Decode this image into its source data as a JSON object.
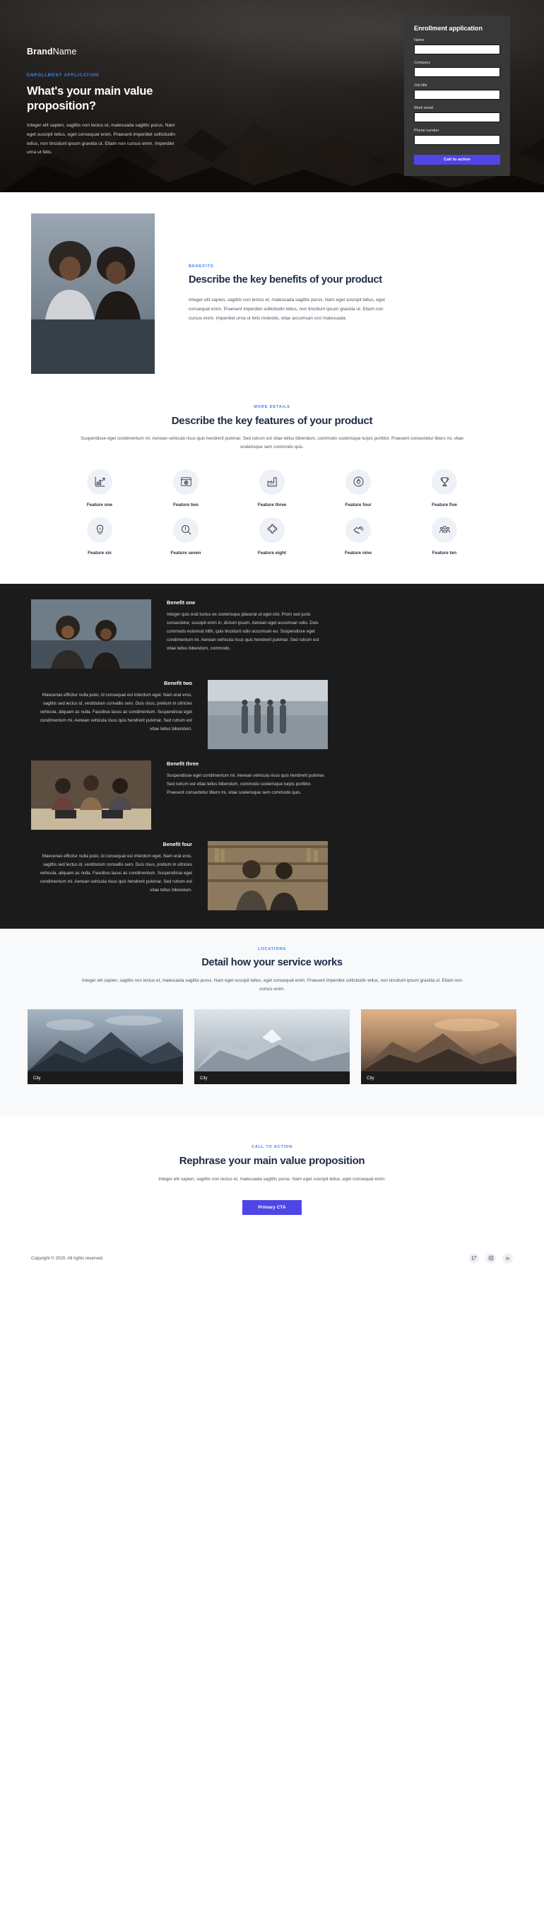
{
  "hero": {
    "brand_bold": "Brand",
    "brand_light": "Name",
    "eyebrow": "ENROLLMENT APPLICATION",
    "headline": "What's your main value proposition?",
    "paragraph": "Integer elit sapien, sagittis non lectus et, malesuada sagittis purus. Nam eget suscipit tellus, eget consequat enim. Praesent imperdiet sollicitudin tellus, non tincidunt ipsum gravida ut. Etiam non cursus enim. Imperdiet urna ut felis.",
    "form": {
      "title": "Enrollment application",
      "fields": [
        {
          "label": "Name",
          "value": "",
          "placeholder": ""
        },
        {
          "label": "Company",
          "value": "",
          "placeholder": ""
        },
        {
          "label": "Job title",
          "value": "",
          "placeholder": ""
        },
        {
          "label": "Work email",
          "value": "",
          "placeholder": ""
        },
        {
          "label": "Phone number",
          "value": "",
          "placeholder": ""
        }
      ],
      "submit_label": "Call to action",
      "submit_color": "#4f46e5"
    }
  },
  "benefits": {
    "eyebrow": "BENEFITS",
    "headline": "Describe the key benefits of your product",
    "paragraph": "Integer elit sapien, sagittis non lectus et, malesuada sagittis purus. Nam eget suscipit tellus, eget consequat enim. Praesent imperdiet sollicitudin tellus, non tincidunt ipsum gravida ut. Etiam non cursus enim. Imperdiet urna ut felis molestie, vitae accumsan orci malesuada.",
    "image_alt": "two-women-portrait"
  },
  "features": {
    "eyebrow": "MORE DETAILS",
    "headline": "Describe the key features of your product",
    "paragraph": "Suspendisse eget condimentum mi. Aenean vehicula risus quis hendrerit pulvinar. Sed rutrum est vitae tellus bibendum, commodo scelerisque turpis porttitor. Praesent consectetur libero mi, vitae scelerisque sem commodo quis.",
    "items": [
      {
        "label": "Feature one",
        "icon": "growth-chart-icon"
      },
      {
        "label": "Feature two",
        "icon": "browser-window-icon"
      },
      {
        "label": "Feature three",
        "icon": "factory-icon"
      },
      {
        "label": "Feature four",
        "icon": "flame-icon"
      },
      {
        "label": "Feature five",
        "icon": "trophy-icon"
      },
      {
        "label": "Feature six",
        "icon": "lightbulb-bolt-icon"
      },
      {
        "label": "Feature seven",
        "icon": "search-alert-icon"
      },
      {
        "label": "Feature eight",
        "icon": "puzzle-piece-icon"
      },
      {
        "label": "Feature nine",
        "icon": "handshake-icon"
      },
      {
        "label": "Feature ten",
        "icon": "group-people-icon"
      }
    ]
  },
  "dark_benefits": {
    "items": [
      {
        "title": "Benefit one",
        "body": "Integer quis erat luctus ex scelerisque placerat ut eget nisl. Proin sed justo consectetur, suscipit enim in, dictum ipsum. Aenean eget accumsan odio. Duis commodo euismod nibh, quis tincidunt odio accumsan eu. Suspendisse eget condimentum mi. Aenean vehicula risus quis hendrerit pulvinar. Sed rutrum est vitae tellus bibendum, commodo.",
        "align": "left",
        "image_alt": "friends-selfie-street"
      },
      {
        "title": "Benefit two",
        "body": "Maecenas efficitur nulla justo, id consequat est interdum eget. Nam erat eros, sagittis sed lectus id, vestibulum convallis sem. Duis risus, pretium in ultricies vehicula, aliquam ac nulla. Faucibus lacus ac condimentum. Suspendisse eget condimentum mi. Aenean vehicula risus quis hendrerit pulvinar. Sed rutrum est vitae tellus bibendum.",
        "align": "right",
        "image_alt": "group-walking-outdoors"
      },
      {
        "title": "Benefit three",
        "body": "Suspendisse eget condimentum mi. Aenean vehicula risus quis hendrerit pulvinar. Sed rutrum est vitae tellus bibendum, commodo scelerisque turpis porttitor. Praesent consectetur libero mi, vitae scelerisque sem commodo quis.",
        "align": "left",
        "image_alt": "students-with-laptops"
      },
      {
        "title": "Benefit four",
        "body": "Maecenas efficitur nulla justo, id consequat est interdum eget. Nam erat eros, sagittis sed lectus id, vestibulum convallis sem. Duis risus, pretium in ultricies vehicula, aliquam ac nulla. Faucibus lacus ac condimentum. Suspendisse eget condimentum mi. Aenean vehicula risus quis hendrerit pulvinar. Sed rutrum est vitae tellus bibendum.",
        "align": "right",
        "image_alt": "two-men-library"
      }
    ]
  },
  "locations": {
    "eyebrow": "LOCATIONS",
    "headline": "Detail how your service works",
    "paragraph": "Integer elit sapien, sagittis non lectus et, malesuada sagittis purus. Nam eget suscipit tellus, eget consequat enim. Praesent imperdiet sollicitudin tellus, non tincidunt ipsum gravida ut. Etiam non cursus enim.",
    "cards": [
      {
        "caption": "City",
        "image_alt": "mountain-dusk"
      },
      {
        "caption": "City",
        "image_alt": "mountain-snow"
      },
      {
        "caption": "City",
        "image_alt": "mountain-sunset"
      }
    ]
  },
  "final_cta": {
    "eyebrow": "CALL TO ACTION",
    "headline": "Rephrase your main value proposition",
    "paragraph": "Integer elit sapien, sagittis non lectus et, malesuada sagittis purus. Nam eget suscipit tellus, eget consequat enim.",
    "button_label": "Primary CTA",
    "button_color": "#4f46e5"
  },
  "footer": {
    "copyright": "Copyright © 2020. All rights reserved.",
    "socials": [
      {
        "name": "twitter-icon"
      },
      {
        "name": "instagram-icon"
      },
      {
        "name": "linkedin-icon"
      }
    ]
  },
  "theme": {
    "accent_blue": "#3b82f6",
    "primary_purple": "#4f46e5",
    "dark_bg": "#1b1b1b",
    "heading_navy": "#1f2a44"
  }
}
